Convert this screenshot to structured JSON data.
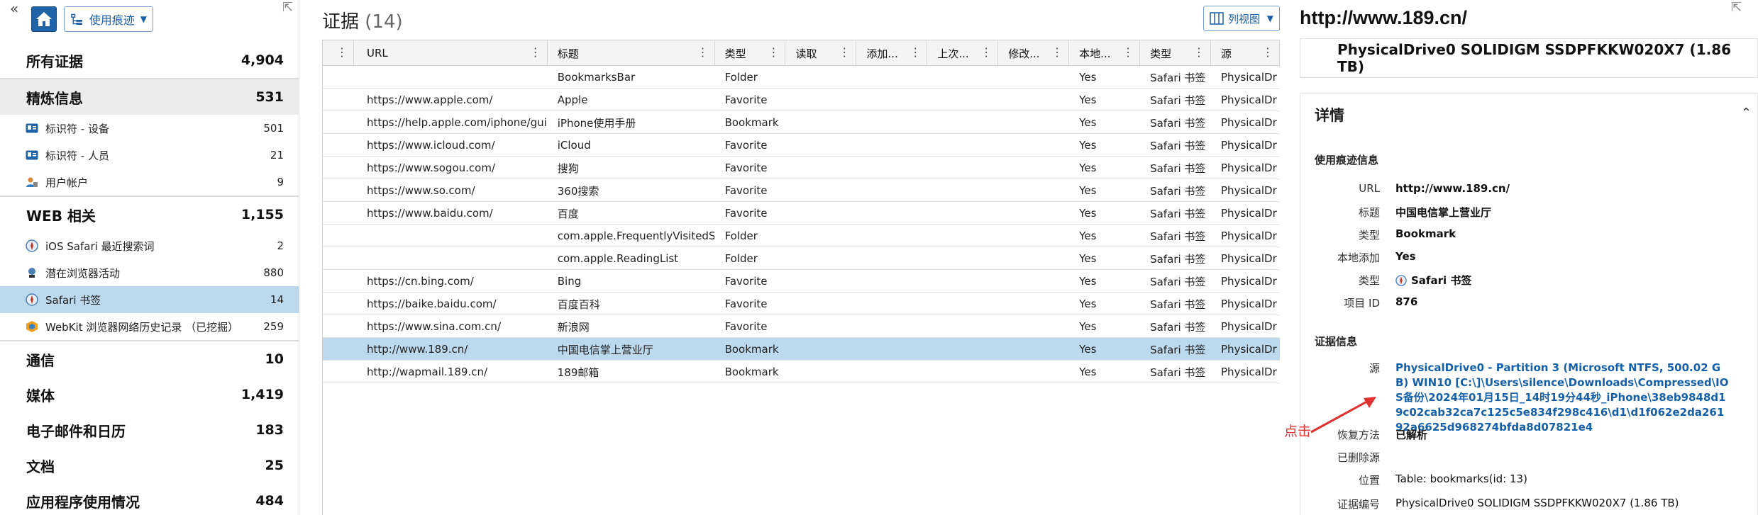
{
  "left_panel": {
    "collapse_glyph": "«",
    "mode_label": "使用痕迹",
    "groups": [
      {
        "label": "所有证据",
        "count": "4,904"
      },
      {
        "label": "精炼信息",
        "count": "531"
      },
      {
        "label": "WEB 相关",
        "count": "1,155"
      },
      {
        "label": "通信",
        "count": "10"
      },
      {
        "label": "媒体",
        "count": "1,419"
      },
      {
        "label": "电子邮件和日历",
        "count": "183"
      },
      {
        "label": "文档",
        "count": "25"
      },
      {
        "label": "应用程序使用情况",
        "count": "484"
      }
    ],
    "refined_items": [
      {
        "label": "标识符 - 设备",
        "count": "501",
        "icon": "id-card-icon"
      },
      {
        "label": "标识符 - 人员",
        "count": "21",
        "icon": "id-card-icon"
      },
      {
        "label": "用户帐户",
        "count": "9",
        "icon": "user-account-icon"
      }
    ],
    "web_items": [
      {
        "label": "iOS Safari 最近搜索词",
        "count": "2",
        "icon": "safari-icon"
      },
      {
        "label": "潜在浏览器活动",
        "count": "880",
        "icon": "browser-activity-icon"
      },
      {
        "label": "Safari 书签",
        "count": "14",
        "icon": "safari-icon"
      },
      {
        "label": "WebKit 浏览器网络历史记录 （已挖掘）",
        "count": "259",
        "icon": "webkit-icon"
      }
    ]
  },
  "evidence": {
    "title": "证据",
    "count": "(14)",
    "view_label": "列视图",
    "columns": [
      "",
      "URL",
      "标题",
      "类型",
      "读取",
      "添加...",
      "上次...",
      "修改...",
      "本地...",
      "类型",
      "源"
    ],
    "rows": [
      [
        "",
        "",
        "BookmarksBar",
        "Folder",
        "",
        "",
        "",
        "",
        "Yes",
        "Safari 书签",
        "PhysicalDr"
      ],
      [
        "",
        "https://www.apple.com/",
        "Apple",
        "Favorite",
        "",
        "",
        "",
        "",
        "Yes",
        "Safari 书签",
        "PhysicalDr"
      ],
      [
        "",
        "https://help.apple.com/iphone/guide/",
        "iPhone使用手册",
        "Bookmark",
        "",
        "",
        "",
        "",
        "Yes",
        "Safari 书签",
        "PhysicalDr"
      ],
      [
        "",
        "https://www.icloud.com/",
        "iCloud",
        "Favorite",
        "",
        "",
        "",
        "",
        "Yes",
        "Safari 书签",
        "PhysicalDr"
      ],
      [
        "",
        "https://www.sogou.com/",
        "搜狗",
        "Favorite",
        "",
        "",
        "",
        "",
        "Yes",
        "Safari 书签",
        "PhysicalDr"
      ],
      [
        "",
        "https://www.so.com/",
        "360搜索",
        "Favorite",
        "",
        "",
        "",
        "",
        "Yes",
        "Safari 书签",
        "PhysicalDr"
      ],
      [
        "",
        "https://www.baidu.com/",
        "百度",
        "Favorite",
        "",
        "",
        "",
        "",
        "Yes",
        "Safari 书签",
        "PhysicalDr"
      ],
      [
        "",
        "",
        "com.apple.FrequentlyVisitedSites",
        "Folder",
        "",
        "",
        "",
        "",
        "Yes",
        "Safari 书签",
        "PhysicalDr"
      ],
      [
        "",
        "",
        "com.apple.ReadingList",
        "Folder",
        "",
        "",
        "",
        "",
        "Yes",
        "Safari 书签",
        "PhysicalDr"
      ],
      [
        "",
        "https://cn.bing.com/",
        "Bing",
        "Favorite",
        "",
        "",
        "",
        "",
        "Yes",
        "Safari 书签",
        "PhysicalDr"
      ],
      [
        "",
        "https://baike.baidu.com/",
        "百度百科",
        "Favorite",
        "",
        "",
        "",
        "",
        "Yes",
        "Safari 书签",
        "PhysicalDr"
      ],
      [
        "",
        "https://www.sina.com.cn/",
        "新浪网",
        "Favorite",
        "",
        "",
        "",
        "",
        "Yes",
        "Safari 书签",
        "PhysicalDr"
      ],
      [
        "",
        "http://www.189.cn/",
        "中国电信掌上营业厅",
        "Bookmark",
        "",
        "",
        "",
        "",
        "Yes",
        "Safari 书签",
        "PhysicalDr"
      ],
      [
        "",
        "http://wapmail.189.cn/",
        "189邮箱",
        "Bookmark",
        "",
        "",
        "",
        "",
        "Yes",
        "Safari 书签",
        "PhysicalDr"
      ]
    ],
    "selected_row": 12
  },
  "details": {
    "title": "http://www.189.cn/",
    "drive": "PhysicalDrive0 SOLIDIGM SSDPFKKW020X7 (1.86 TB)",
    "header": "详情",
    "usage_section": "使用痕迹信息",
    "usage": [
      {
        "k": "URL",
        "v": "http://www.189.cn/"
      },
      {
        "k": "标题",
        "v": "中国电信掌上营业厅"
      },
      {
        "k": "类型",
        "v": "Bookmark"
      },
      {
        "k": "本地添加",
        "v": "Yes"
      },
      {
        "k": "类型",
        "v": "Safari 书签"
      },
      {
        "k": "项目 ID",
        "v": "876"
      }
    ],
    "evidence_section": "证据信息",
    "source_label": "源",
    "source_value": "PhysicalDrive0 - Partition 3 (Microsoft NTFS, 500.02 GB) WIN10 [C:\\]\\Users\\silence\\Downloads\\Compressed\\IOS备份\\2024年01月15日_14时19分44秒_iPhone\\38eb9848d19c02cab32ca7c125c5e834f298c416\\d1\\d1f062e2da26192a6625d968274bfda8d07821e4",
    "evidence": [
      {
        "k": "恢复方法",
        "v": "已解析"
      },
      {
        "k": "已删除源",
        "v": ""
      },
      {
        "k": "位置",
        "v": "Table: bookmarks(id: 13)"
      },
      {
        "k": "证据编号",
        "v": "PhysicalDrive0 SOLIDIGM SSDPFKKW020X7 (1.86 TB)"
      }
    ]
  },
  "annotation": "点击",
  "colors": {
    "accent": "#1f63a8",
    "selected": "#bcd9ee",
    "link": "#1560a8",
    "annotation": "#e03030"
  }
}
